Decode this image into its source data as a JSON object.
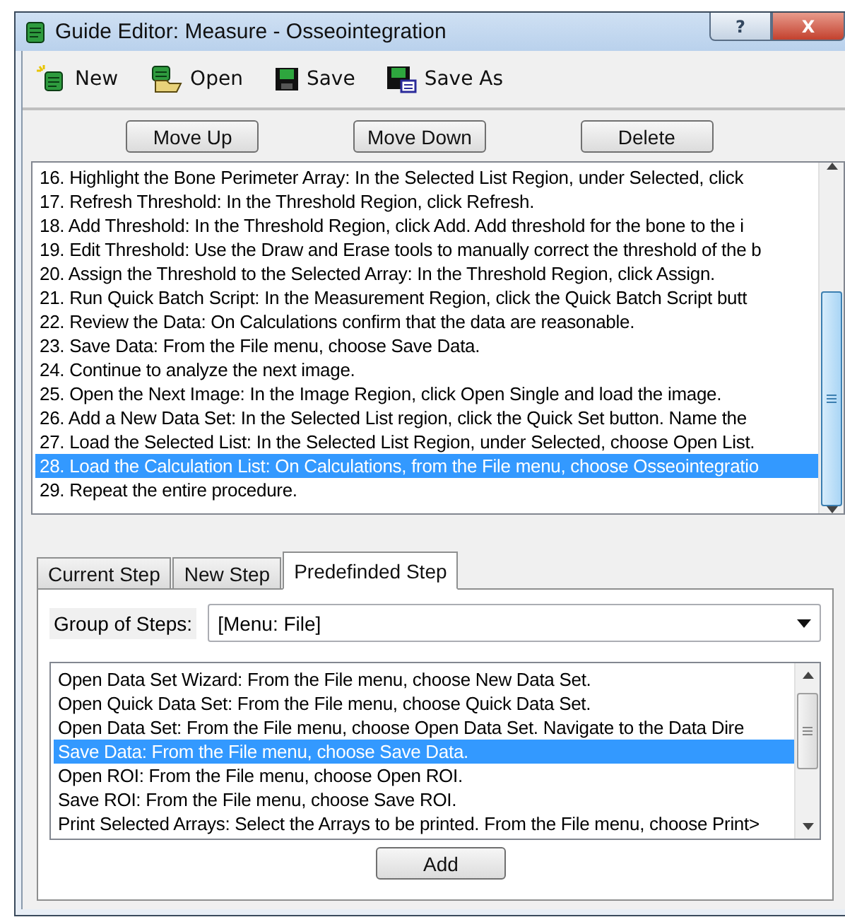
{
  "window": {
    "title": "Guide Editor: Measure - Osseointegration",
    "help_button": "?",
    "close_button": "X"
  },
  "toolbar": [
    {
      "label": "New",
      "kind": "new"
    },
    {
      "label": "Open",
      "kind": "open"
    },
    {
      "label": "Save",
      "kind": "save"
    },
    {
      "label": "Save As",
      "kind": "saveas"
    }
  ],
  "step_buttons": [
    "Move Up",
    "Move Down",
    "Delete"
  ],
  "steps": [
    {
      "text": "16. Highlight the Bone Perimeter Array: In the Selected List Region, under Selected,  click",
      "selected": false
    },
    {
      "text": "17. Refresh Threshold: In the Threshold Region, click Refresh.",
      "selected": false
    },
    {
      "text": "18. Add Threshold: In the Threshold Region, click Add. Add threshold for the bone to the i",
      "selected": false
    },
    {
      "text": "19. Edit Threshold: Use the Draw and Erase tools to manually correct the threshold of the b",
      "selected": false
    },
    {
      "text": "20. Assign the Threshold to the Selected Array:  In the Threshold Region, click Assign.",
      "selected": false
    },
    {
      "text": "21. Run Quick Batch Script: In the Measurement Region, click the Quick Batch Script butt",
      "selected": false
    },
    {
      "text": "22. Review the Data: On Calculations confirm that the data are reasonable.",
      "selected": false
    },
    {
      "text": "23. Save Data: From the File menu, choose Save Data.",
      "selected": false
    },
    {
      "text": "24. Continue to analyze the next image.",
      "selected": false
    },
    {
      "text": "25. Open the Next Image: In the Image Region, click Open Single and load the image.",
      "selected": false
    },
    {
      "text": "26. Add a New Data Set: In the Selected List region, click the Quick Set button. Name the",
      "selected": false
    },
    {
      "text": "27. Load the Selected List: In the Selected List Region, under Selected, choose Open List.",
      "selected": false
    },
    {
      "text": "28. Load the Calculation List: On Calculations, from the File menu, choose Osseointegratio",
      "selected": true
    },
    {
      "text": "29. Repeat the entire procedure.",
      "selected": false
    }
  ],
  "tabs": [
    {
      "label": "Current Step",
      "selected": false
    },
    {
      "label": "New Step",
      "selected": false
    },
    {
      "label": "Predefinded Step",
      "selected": true
    }
  ],
  "group_of_steps": {
    "label": "Group of Steps:",
    "value": "[Menu: File]"
  },
  "predefined_steps": [
    {
      "text": "Open Data Set Wizard: From the File menu, choose New Data Set.",
      "selected": false
    },
    {
      "text": "Open Quick Data Set: From the File menu, choose Quick Data Set.",
      "selected": false
    },
    {
      "text": "Open Data Set: From the File menu, choose Open Data Set.  Navigate to the Data Dire",
      "selected": false
    },
    {
      "text": "Save Data: From the File menu, choose Save Data.",
      "selected": true
    },
    {
      "text": "Open ROI: From the File menu, choose Open ROI.",
      "selected": false
    },
    {
      "text": "Save ROI: From the File menu, choose Save ROI.",
      "selected": false
    },
    {
      "text": "Print Selected Arrays: Select the Arrays to be printed. From the File menu, choose Print>",
      "selected": false
    }
  ],
  "add_button": "Add"
}
